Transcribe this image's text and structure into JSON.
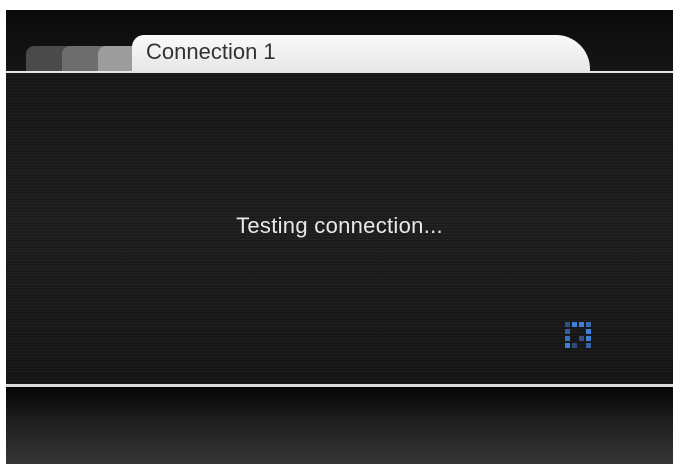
{
  "window": {
    "active_tab_label": "Connection 1",
    "inactive_tabs": [
      "",
      "",
      ""
    ]
  },
  "dialog": {
    "status_message": "Testing connection...",
    "activity_icon": "loading-spinner-icon",
    "accent_color": "#3d7fd9"
  }
}
